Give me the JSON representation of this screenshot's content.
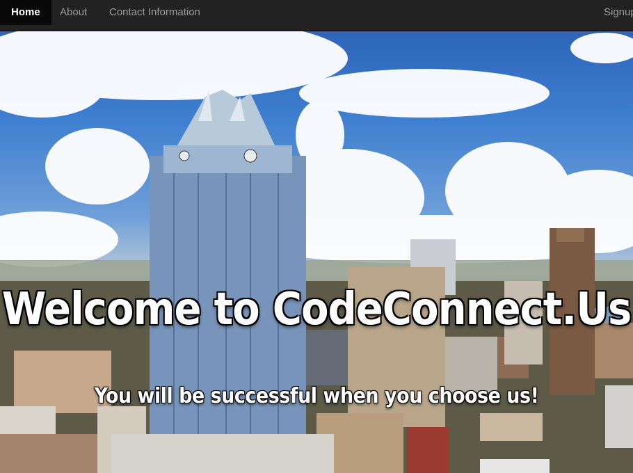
{
  "nav": {
    "items": [
      {
        "label": "Home",
        "active": true
      },
      {
        "label": "About",
        "active": false
      },
      {
        "label": "Contact Information",
        "active": false
      }
    ],
    "signup_label": "Signup"
  },
  "hero": {
    "title": "Welcome to CodeConnect.Us",
    "subtitle": "You will be successful when you choose us!"
  },
  "colors": {
    "navbar_bg": "#222222",
    "active_bg": "#080808",
    "nav_text": "#9d9d9d",
    "hero_text": "#ffffff"
  }
}
